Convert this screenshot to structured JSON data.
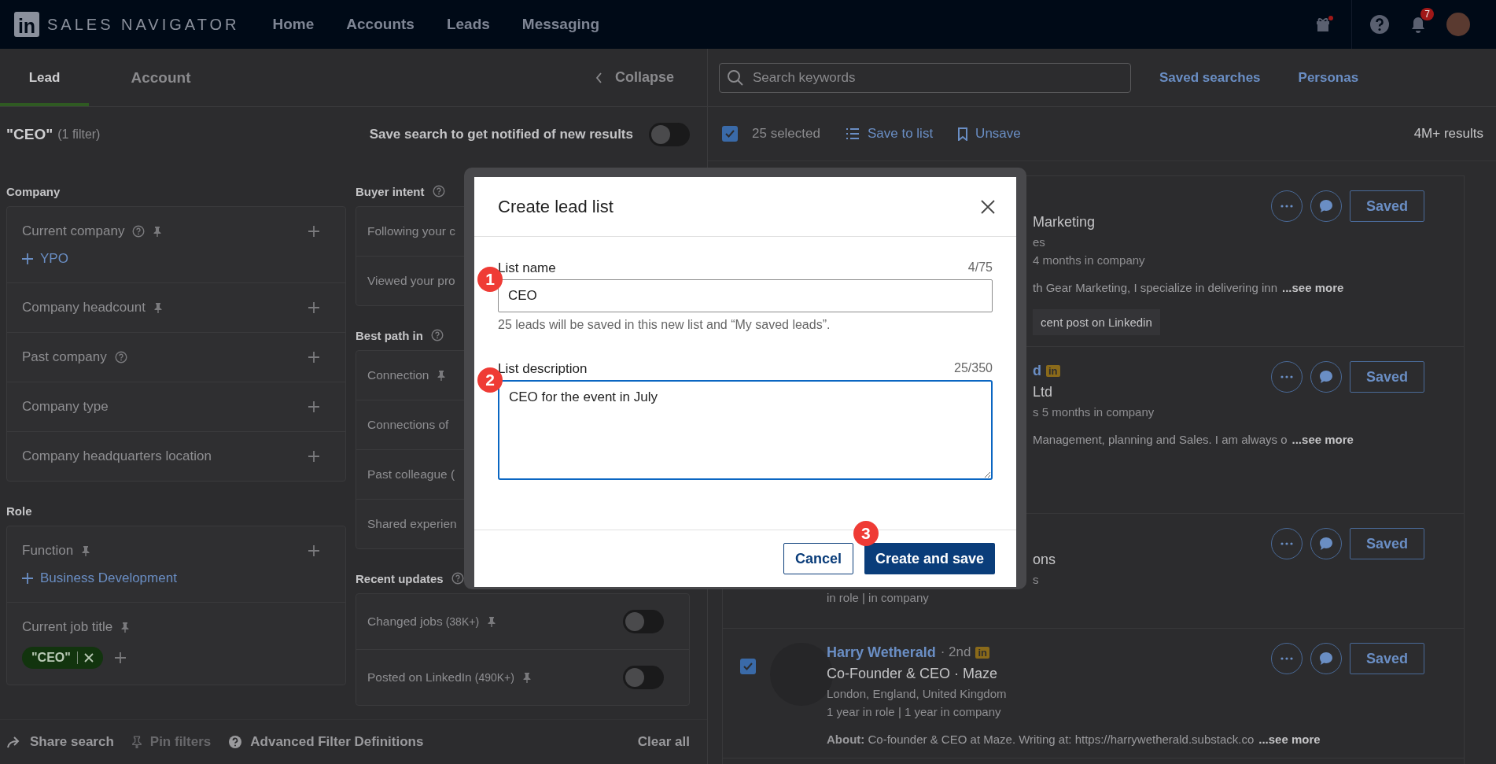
{
  "nav": {
    "logo_text": "in",
    "brand": "SALES NAVIGATOR",
    "links": [
      {
        "label": "Home"
      },
      {
        "label": "Accounts"
      },
      {
        "label": "Leads"
      },
      {
        "label": "Messaging"
      }
    ],
    "notification_count": "7"
  },
  "filter_panel": {
    "tabs": [
      {
        "label": "Lead",
        "selected": true
      },
      {
        "label": "Account",
        "selected": false
      }
    ],
    "collapse": "Collapse",
    "query": "\"CEO\"",
    "filter_count": "(1 filter)",
    "save_search": {
      "label": "Save search to get notified of new results",
      "on": false
    },
    "columns": [
      [
        {
          "title": "Company",
          "help": false,
          "items": [
            {
              "kind": "add",
              "label": "Current company",
              "help": true,
              "pinned": true,
              "values": [
                {
                  "kind": "include",
                  "label": "YPO"
                }
              ]
            },
            {
              "kind": "add",
              "label": "Company headcount",
              "help": false,
              "pinned": true
            },
            {
              "kind": "add",
              "label": "Past company",
              "help": true,
              "pinned": false
            },
            {
              "kind": "add",
              "label": "Company type",
              "help": false,
              "pinned": false
            },
            {
              "kind": "add",
              "label": "Company headquarters location",
              "help": false,
              "pinned": false
            }
          ]
        },
        {
          "title": "Role",
          "help": false,
          "items": [
            {
              "kind": "add",
              "label": "Function",
              "help": false,
              "pinned": true,
              "values": [
                {
                  "kind": "include",
                  "label": "Business Development"
                }
              ]
            },
            {
              "kind": "tags",
              "label": "Current job title",
              "help": false,
              "pinned": true,
              "values": [
                {
                  "kind": "tag",
                  "label": "\"CEO\""
                }
              ]
            }
          ]
        }
      ],
      [
        {
          "title": "Buyer intent",
          "help": true,
          "items": [
            {
              "kind": "plain",
              "label": "Following your c",
              "help": false,
              "pinned": false
            },
            {
              "kind": "plain",
              "label": "Viewed your pro",
              "help": false,
              "pinned": false
            }
          ]
        },
        {
          "title": "Best path in",
          "help": true,
          "items": [
            {
              "kind": "plain",
              "label": "Connection",
              "help": false,
              "pinned": true
            },
            {
              "kind": "plain",
              "label": "Connections of",
              "help": false,
              "pinned": false
            },
            {
              "kind": "plain",
              "label": "Past colleague (",
              "help": false,
              "pinned": false
            },
            {
              "kind": "plain",
              "label": "Shared experien",
              "help": false,
              "pinned": false
            }
          ]
        },
        {
          "title": "Recent updates",
          "help": true,
          "items": [
            {
              "kind": "toggle",
              "label": "Changed jobs",
              "count": "(38K+)",
              "help": false,
              "pinned": true,
              "on": false
            },
            {
              "kind": "toggle",
              "label": "Posted on LinkedIn",
              "count": "(490K+)",
              "help": false,
              "pinned": true,
              "on": false
            }
          ]
        }
      ]
    ],
    "footer": [
      {
        "kind": "share",
        "label": "Share search",
        "disabled": false
      },
      {
        "kind": "pin",
        "label": "Pin filters",
        "disabled": true
      },
      {
        "kind": "help",
        "label": "Advanced Filter Definitions",
        "disabled": false
      }
    ],
    "clear_all": "Clear all"
  },
  "results": {
    "search": {
      "placeholder": "Search keywords"
    },
    "links": [
      {
        "label": "Saved searches"
      },
      {
        "label": "Personas"
      }
    ],
    "toolbar": {
      "all_checked": true,
      "selected": "25 selected",
      "save_to_list": "Save to list",
      "unsave": "Unsave",
      "total": "4M+ results"
    },
    "leads": [
      {
        "lines": [
          {
            "kind": "title",
            "covered": true,
            "text": "Marketing"
          },
          {
            "kind": "meta",
            "covered": true,
            "text": "es"
          },
          {
            "kind": "meta",
            "covered": true,
            "text": "4 months in company"
          },
          {
            "kind": "about",
            "covered": true,
            "text": "th Gear Marketing, I specialize in delivering inn",
            "more": "...see more"
          },
          {
            "kind": "chip",
            "covered": true,
            "text": "cent post on Linkedin"
          }
        ],
        "save": "Saved"
      },
      {
        "lines": [
          {
            "kind": "name",
            "covered": true,
            "text": "d",
            "badge": "in"
          },
          {
            "kind": "title",
            "covered": true,
            "text": "Ltd"
          },
          {
            "kind": "meta",
            "covered": true,
            "text": "s 5 months in company"
          },
          {
            "kind": "about",
            "covered": true,
            "text": "Management, planning and Sales. I am always o",
            "more": "...see more"
          }
        ],
        "save": "Saved"
      },
      {
        "lines": [
          {
            "kind": "title",
            "covered": true,
            "text": "ons"
          },
          {
            "kind": "meta",
            "covered": true,
            "text": "s"
          },
          {
            "kind": "meta",
            "covered": false,
            "text": "in role | in company"
          }
        ],
        "save": "Saved"
      },
      {
        "checked": true,
        "lines": [
          {
            "kind": "name",
            "covered": false,
            "text": "Harry Wetherald",
            "degree": "· 2nd",
            "badge": "in"
          },
          {
            "kind": "title",
            "covered": false,
            "text": "Co-Founder & CEO · Maze"
          },
          {
            "kind": "meta",
            "covered": false,
            "text": "London, England, United Kingdom"
          },
          {
            "kind": "meta",
            "covered": false,
            "text": "1 year in role | 1 year in company"
          },
          {
            "kind": "about",
            "covered": false,
            "text": "**About:** Co-founder & CEO at Maze. Writing at: https://harrywetherald.substack.co",
            "more": "...see more"
          }
        ],
        "save": "Saved"
      }
    ]
  },
  "dialog": {
    "title": "Create lead list",
    "fields": [
      {
        "kind": "input",
        "step": "1",
        "label": "List name",
        "counter": "4/75",
        "value": "CEO",
        "hint": "25 leads will be saved in this new list and “My saved leads”."
      },
      {
        "kind": "textarea",
        "step": "2",
        "label": "List description",
        "counter": "25/350",
        "value": "CEO for the event in July"
      }
    ],
    "buttons": [
      {
        "kind": "secondary",
        "label": "Cancel"
      },
      {
        "kind": "primary",
        "label": "Create and save",
        "step": "3"
      }
    ]
  }
}
